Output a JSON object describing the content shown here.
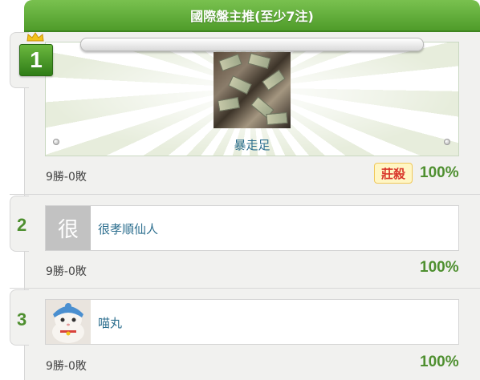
{
  "header": {
    "title": "國際盤主推(至少7注)"
  },
  "featured": {
    "rank": "1",
    "name": "暴走足",
    "record": "9勝-0敗",
    "tag": "莊殺",
    "percentage": "100%"
  },
  "entries": [
    {
      "rank": "2",
      "avatar_text": "很",
      "name": "很孝順仙人",
      "record": "9勝-0敗",
      "percentage": "100%"
    },
    {
      "rank": "3",
      "avatar_text": "",
      "name": "喵丸",
      "record": "9勝-0敗",
      "percentage": "100%"
    }
  ],
  "colors": {
    "header_green": "#5fab37",
    "rank_green": "#4e8f2f",
    "name_blue": "#2d6f8f",
    "tag_red": "#d9352a",
    "tag_bg": "#fff6c4"
  },
  "icons": {
    "crown": "crown-icon",
    "pin": "pin-icon"
  }
}
